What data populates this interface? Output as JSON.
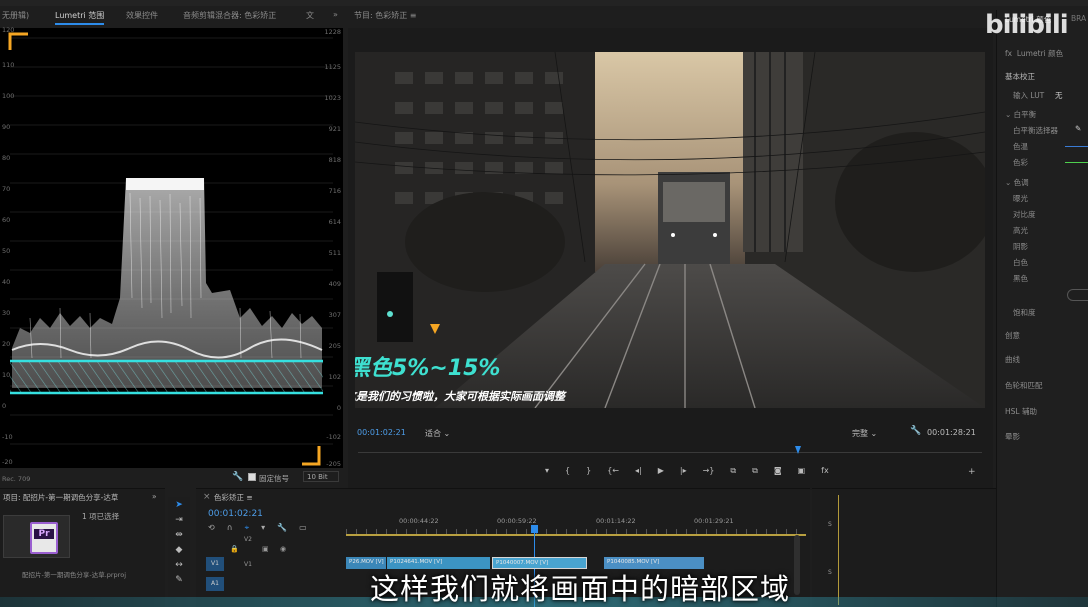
{
  "panels": {
    "tab_left_cut": "无册辑)",
    "tab_lumetri_scopes": "Lumetri 范围",
    "tab_effects": "效果控件",
    "tab_audio_mixer": "音频剪辑混合器: 色彩矫正",
    "tab_cut": "文",
    "overflow": "»",
    "program_title": "节目: 色彩矫正",
    "menu_glyph": "≡"
  },
  "scope": {
    "left_scale": [
      "120",
      "110",
      "100",
      "90",
      "80",
      "70",
      "60",
      "50",
      "40",
      "30",
      "20",
      "10",
      "0",
      "-10",
      "-20"
    ],
    "right_scale": [
      "1228",
      "1125",
      "1023",
      "921",
      "818",
      "716",
      "614",
      "511",
      "409",
      "307",
      "205",
      "102",
      "0",
      "-102",
      "-205"
    ],
    "color_space": "Rec. 709",
    "clamp_label": "固定信号",
    "bit_depth": "10 Bit"
  },
  "monitor": {
    "overlay_title": "黑色5%~15%",
    "overlay_sub": "这是我们的习惯啦，大家可根据实际画面调整",
    "timecode_left": "00:01:02:21",
    "fit": "适合",
    "quality": "完整",
    "timecode_right": "00:01:28:21"
  },
  "lumetri": {
    "title": "Lumetri 颜色",
    "tab_cut": "BRA",
    "fx_name": "Lumetri 颜色",
    "fx": "fx",
    "section_basic": "基本校正",
    "input_lut": "输入 LUT",
    "input_lut_value": "无",
    "white_balance": "白平衡",
    "wb_selector": "白平衡选择器",
    "temp": "色温",
    "tint": "色彩",
    "tone": "色调",
    "exposure": "曝光",
    "contrast": "对比度",
    "highlights": "高光",
    "shadows": "阴影",
    "whites": "白色",
    "blacks": "黑色",
    "saturation": "饱和度",
    "creative": "创意",
    "curves": "曲线",
    "wheels": "色轮和匹配",
    "hsl": "HSL 辅助",
    "vignette": "晕影"
  },
  "project": {
    "title": "项目: 配招片-第一期调色分享-达草",
    "selected": "1 项已选择",
    "file": "配招片-第一期调色分享-达草.prproj",
    "pr_icon": "Pr"
  },
  "timeline": {
    "title": "色彩矫正",
    "timecode": "00:01:02:21",
    "ruler": [
      "00:00:44:22",
      "00:00:59:22",
      "00:01:14:22",
      "00:01:29:21"
    ],
    "tracks": [
      "V2",
      "V1",
      "A1"
    ],
    "clips": [
      "P26.MOV [V]",
      "P1024641.MOV [V]",
      "P1040007.MOV [V]",
      "P1040085.MOV [V]"
    ],
    "letter_s": "S"
  },
  "subtitle": "这样我们就将画面中的暗部区域",
  "watermark": "bilibili"
}
